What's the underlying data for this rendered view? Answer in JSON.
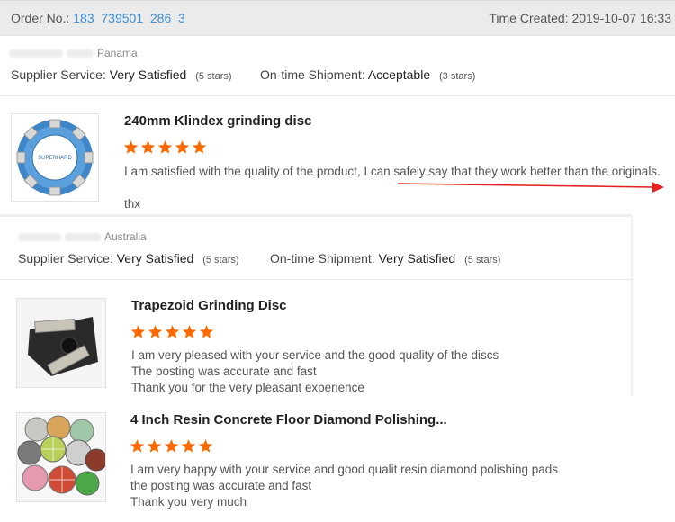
{
  "order": {
    "label": "Order No.:",
    "number": "183  739501  286  3",
    "created_label": "Time Created:",
    "created_value": "2019-10-07 16:33"
  },
  "feedback": [
    {
      "country": "Panama",
      "supplier_service_label": "Supplier Service:",
      "supplier_service_value": "Very Satisfied",
      "supplier_service_stars": "(5 stars)",
      "shipment_label": "On-time Shipment:",
      "shipment_value": "Acceptable",
      "shipment_stars": "(3 stars)",
      "products": [
        {
          "title": "240mm Klindex grinding disc",
          "rating": 5,
          "review_lines": [
            "I am satisfied with the quality of the product, I can safely say that they work better than the originals.",
            "",
            "thx"
          ],
          "image_text": "SUPERHARD"
        }
      ]
    },
    {
      "country": "Australia",
      "supplier_service_label": "Supplier Service:",
      "supplier_service_value": "Very Satisfied",
      "supplier_service_stars": "(5 stars)",
      "shipment_label": "On-time Shipment:",
      "shipment_value": "Very Satisfied",
      "shipment_stars": "(5 stars)",
      "products": [
        {
          "title": "Trapezoid Grinding Disc",
          "rating": 5,
          "review_lines": [
            "I am very pleased with your service and the good quality of the discs",
            "The posting was accurate and fast",
            "Thank you for the very pleasant experience"
          ]
        },
        {
          "title": "4 Inch Resin Concrete Floor Diamond Polishing...",
          "rating": 5,
          "review_lines": [
            "I am very happy with your service and good qualit resin diamond polishing pads",
            "the posting was accurate and fast",
            "Thank you very much"
          ]
        }
      ]
    }
  ],
  "colors": {
    "star": "#ff6a00",
    "order_link": "#3a8fd6",
    "arrow": "#e32222"
  }
}
